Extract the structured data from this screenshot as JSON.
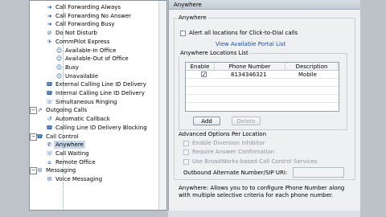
{
  "tree": {
    "items": [
      {
        "label": "Call Forwarding Always",
        "icon": "call-forward-icon",
        "depth": 1
      },
      {
        "label": "Call Forwarding No Answer",
        "icon": "call-forward-icon",
        "depth": 1
      },
      {
        "label": "Call Forwarding Busy",
        "icon": "call-forward-icon",
        "depth": 1
      },
      {
        "label": "Do Not Disturb",
        "icon": "do-not-disturb-icon",
        "depth": 1
      },
      {
        "label": "CommPilot Express",
        "icon": "commpilot-icon",
        "depth": 1
      },
      {
        "label": "Available-In Office",
        "icon": "profile-icon",
        "depth": 2
      },
      {
        "label": "Available-Out of Office",
        "icon": "profile-icon",
        "depth": 2
      },
      {
        "label": "Busy",
        "icon": "profile-icon",
        "depth": 2
      },
      {
        "label": "Unavailable",
        "icon": "profile-icon",
        "depth": 2
      },
      {
        "label": "External Calling Line ID Delivery",
        "icon": "caller-id-icon",
        "depth": 1
      },
      {
        "label": "Internal Calling Line ID Delivery",
        "icon": "caller-id-icon",
        "depth": 1
      },
      {
        "label": "Simultaneous Ringing",
        "icon": "ring-icon",
        "depth": 1
      },
      {
        "label": "Outgoing Calls",
        "icon": "outgoing-calls-icon",
        "depth": 0
      },
      {
        "label": "Automatic Callback",
        "icon": "callback-icon",
        "depth": 1
      },
      {
        "label": "Calling Line ID Delivery Blocking",
        "icon": "caller-id-icon",
        "depth": 1
      },
      {
        "label": "Call Control",
        "icon": "call-control-icon",
        "depth": 0
      },
      {
        "label": "Anywhere",
        "icon": "anywhere-icon",
        "depth": 1,
        "selected": true
      },
      {
        "label": "Call Waiting",
        "icon": "call-waiting-icon",
        "depth": 1
      },
      {
        "label": "Remote Office",
        "icon": "remote-office-icon",
        "depth": 1
      },
      {
        "label": "Messaging",
        "icon": "messaging-icon",
        "depth": 0
      },
      {
        "label": "Voice Messaging",
        "icon": "voicemail-icon",
        "depth": 1
      }
    ]
  },
  "panel": {
    "header": "Anywhere",
    "section_title": "Anywhere",
    "alert_all_label": "Alert all locations for Click-to-Dial calls",
    "portal_link": "View Available Portal List",
    "locations_title": "Anywhere Locations List",
    "columns": [
      "Enable",
      "Phone Number",
      "Description"
    ],
    "rows": [
      {
        "enabled": true,
        "phone": "8134346321",
        "description": "Mobile"
      }
    ],
    "add_label": "Add",
    "delete_label": "Delete",
    "advanced_title": "Advanced Options Per Location",
    "enable_diversion": "Enable Diversion Inhibitor",
    "require_answer": "Require Answer Confirmation",
    "use_broadworks": "Use BroadWorks-based Call Control Services",
    "outbound_label": "Outbound Alternate Number/SIP URI:",
    "outbound_value": "",
    "status_text": "Anywhere: Allows you to to configure Phone Number along with multiple selective criteria for each phone number."
  },
  "colors": {
    "accent": "#1a56a8",
    "selection": "#c9d8ea",
    "panel_bg": "#eef0f2"
  }
}
